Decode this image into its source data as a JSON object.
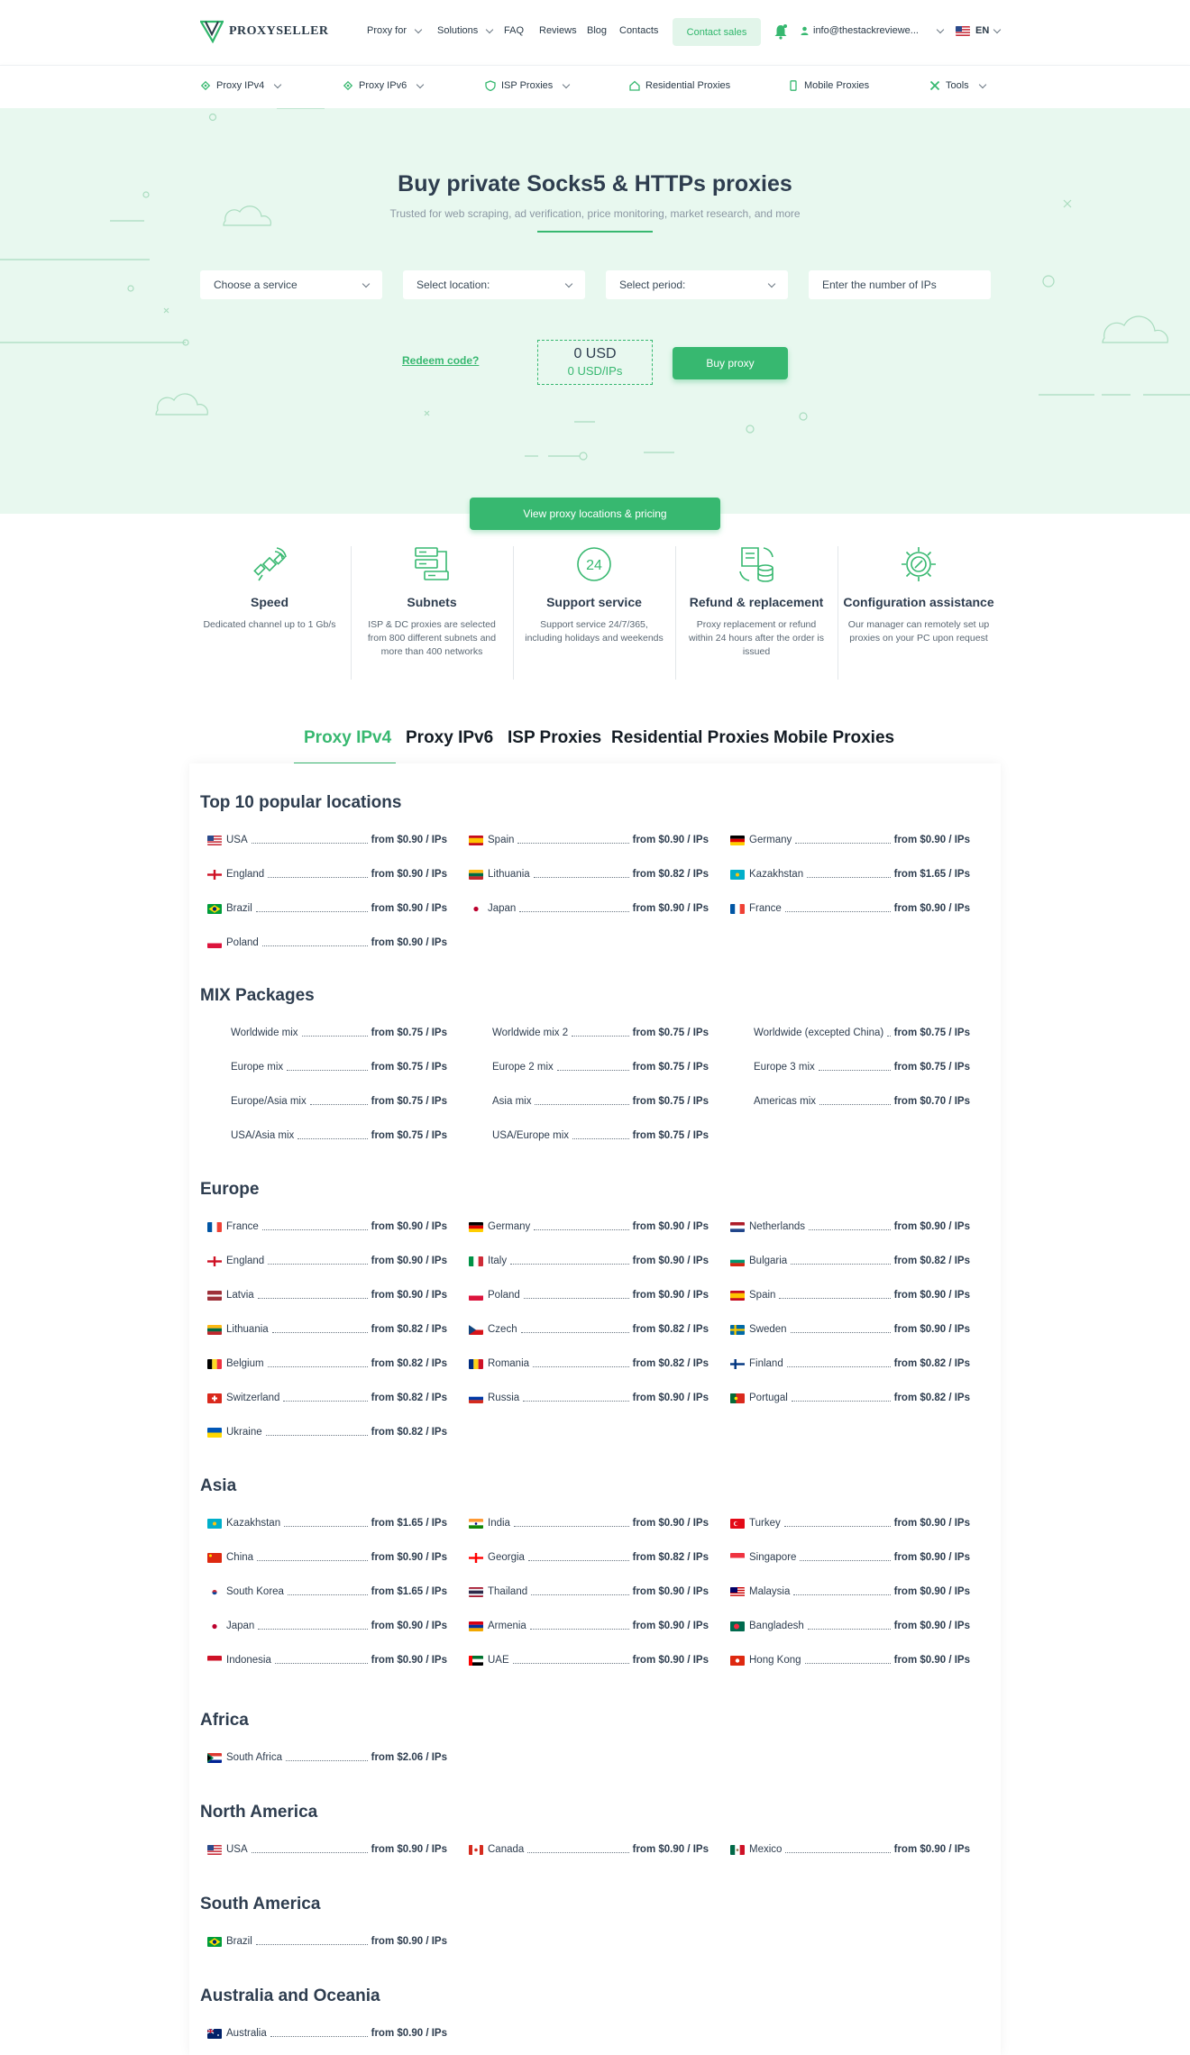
{
  "brand": {
    "name": "PROXYSELLER"
  },
  "header": {
    "nav": [
      "Proxy for",
      "Solutions",
      "FAQ",
      "Reviews",
      "Blog",
      "Contacts"
    ],
    "contact_label": "Contact sales",
    "email": "info@thestackreviewe...",
    "language": "EN"
  },
  "subnav": [
    "Proxy IPv4",
    "Proxy IPv6",
    "ISP Proxies",
    "Residential Proxies",
    "Mobile Proxies",
    "Tools"
  ],
  "hero": {
    "title": "Buy private Socks5 & HTTPs proxies",
    "subtitle": "Trusted for web scraping, ad verification, price monitoring, market research, and more",
    "service_placeholder": "Choose a service",
    "location_placeholder": "Select location:",
    "period_placeholder": "Select period:",
    "ips_placeholder": "Enter the number of IPs",
    "redeem": "Redeem code?",
    "total_usd": "0 USD",
    "total_per_ip": "0 USD/IPs",
    "buy": "Buy proxy",
    "view_locations": "View proxy locations & pricing"
  },
  "features": [
    {
      "title": "Speed",
      "desc": "Dedicated channel up to 1 Gb/s"
    },
    {
      "title": "Subnets",
      "desc": "ISP & DC proxies are selected from 800 different subnets and more than 400 networks"
    },
    {
      "title": "Support service",
      "desc": "Support service 24/7/365, including holidays and weekends"
    },
    {
      "title": "Refund & replacement",
      "desc": "Proxy replacement or refund within 24 hours after the order is issued"
    },
    {
      "title": "Configuration assistance",
      "desc": "Our manager can remotely set up proxies on your PC upon request"
    }
  ],
  "tabs": [
    "Proxy IPv4",
    "Proxy IPv6",
    "ISP Proxies",
    "Residential Proxies",
    "Mobile Proxies"
  ],
  "sections": [
    {
      "title": "Top 10 popular locations",
      "items": [
        {
          "name": "USA",
          "price": "from $0.90 / IPs",
          "flag": "us"
        },
        {
          "name": "Spain",
          "price": "from $0.90 / IPs",
          "flag": "es"
        },
        {
          "name": "Germany",
          "price": "from $0.90 / IPs",
          "flag": "de"
        },
        {
          "name": "England",
          "price": "from $0.90 / IPs",
          "flag": "en"
        },
        {
          "name": "Lithuania",
          "price": "from $0.82 / IPs",
          "flag": "lt"
        },
        {
          "name": "Kazakhstan",
          "price": "from $1.65 / IPs",
          "flag": "kz"
        },
        {
          "name": "Brazil",
          "price": "from $0.90 / IPs",
          "flag": "br"
        },
        {
          "name": "Japan",
          "price": "from $0.90 / IPs",
          "flag": "jp"
        },
        {
          "name": "France",
          "price": "from $0.90 / IPs",
          "flag": "fr"
        },
        {
          "name": "Poland",
          "price": "from $0.90 / IPs",
          "flag": "pl"
        }
      ]
    },
    {
      "title": "MIX Packages",
      "items": [
        {
          "name": "Worldwide mix",
          "price": "from $0.75 / IPs"
        },
        {
          "name": "Worldwide mix 2",
          "price": "from $0.75 / IPs"
        },
        {
          "name": "Worldwide (excepted China)",
          "price": "from $0.75 / IPs"
        },
        {
          "name": "Europe mix",
          "price": "from $0.75 / IPs"
        },
        {
          "name": "Europe 2 mix",
          "price": "from $0.75 / IPs"
        },
        {
          "name": "Europe 3 mix",
          "price": "from $0.75 / IPs"
        },
        {
          "name": "Europe/Asia mix",
          "price": "from $0.75 / IPs"
        },
        {
          "name": "Asia mix",
          "price": "from $0.75 / IPs"
        },
        {
          "name": "Americas mix",
          "price": "from $0.70 / IPs"
        },
        {
          "name": "USA/Asia mix",
          "price": "from $0.75 / IPs"
        },
        {
          "name": "USA/Europe mix",
          "price": "from $0.75 / IPs"
        }
      ]
    },
    {
      "title": "Europe",
      "items": [
        {
          "name": "France",
          "price": "from $0.90 / IPs",
          "flag": "fr"
        },
        {
          "name": "Germany",
          "price": "from $0.90 / IPs",
          "flag": "de"
        },
        {
          "name": "Netherlands",
          "price": "from $0.90 / IPs",
          "flag": "nl"
        },
        {
          "name": "England",
          "price": "from $0.90 / IPs",
          "flag": "en"
        },
        {
          "name": "Italy",
          "price": "from $0.90 / IPs",
          "flag": "it"
        },
        {
          "name": "Bulgaria",
          "price": "from $0.82 / IPs",
          "flag": "bg"
        },
        {
          "name": "Latvia",
          "price": "from $0.90 / IPs",
          "flag": "lv"
        },
        {
          "name": "Poland",
          "price": "from $0.90 / IPs",
          "flag": "pl"
        },
        {
          "name": "Spain",
          "price": "from $0.90 / IPs",
          "flag": "es"
        },
        {
          "name": "Lithuania",
          "price": "from $0.82 / IPs",
          "flag": "lt"
        },
        {
          "name": "Czech",
          "price": "from $0.82 / IPs",
          "flag": "cz"
        },
        {
          "name": "Sweden",
          "price": "from $0.90 / IPs",
          "flag": "se"
        },
        {
          "name": "Belgium",
          "price": "from $0.82 / IPs",
          "flag": "be"
        },
        {
          "name": "Romania",
          "price": "from $0.82 / IPs",
          "flag": "ro"
        },
        {
          "name": "Finland",
          "price": "from $0.82 / IPs",
          "flag": "fi"
        },
        {
          "name": "Switzerland",
          "price": "from $0.82 / IPs",
          "flag": "ch"
        },
        {
          "name": "Russia",
          "price": "from $0.90 / IPs",
          "flag": "ru"
        },
        {
          "name": "Portugal",
          "price": "from $0.82 / IPs",
          "flag": "pt"
        },
        {
          "name": "Ukraine",
          "price": "from $0.82 / IPs",
          "flag": "ua"
        }
      ]
    },
    {
      "title": "Asia",
      "items": [
        {
          "name": "Kazakhstan",
          "price": "from $1.65 / IPs",
          "flag": "kz"
        },
        {
          "name": "India",
          "price": "from $0.90 / IPs",
          "flag": "in"
        },
        {
          "name": "Turkey",
          "price": "from $0.90 / IPs",
          "flag": "tr"
        },
        {
          "name": "China",
          "price": "from $0.90 / IPs",
          "flag": "cn"
        },
        {
          "name": "Georgia",
          "price": "from $0.82 / IPs",
          "flag": "ge"
        },
        {
          "name": "Singapore",
          "price": "from $0.90 / IPs",
          "flag": "sg"
        },
        {
          "name": "South Korea",
          "price": "from $1.65 / IPs",
          "flag": "kr"
        },
        {
          "name": "Thailand",
          "price": "from $0.90 / IPs",
          "flag": "th"
        },
        {
          "name": "Malaysia",
          "price": "from $0.90 / IPs",
          "flag": "my"
        },
        {
          "name": "Japan",
          "price": "from $0.90 / IPs",
          "flag": "jp"
        },
        {
          "name": "Armenia",
          "price": "from $0.90 / IPs",
          "flag": "am"
        },
        {
          "name": "Bangladesh",
          "price": "from $0.90 / IPs",
          "flag": "bd"
        },
        {
          "name": "Indonesia",
          "price": "from $0.90 / IPs",
          "flag": "id"
        },
        {
          "name": "UAE",
          "price": "from $0.90 / IPs",
          "flag": "ae"
        },
        {
          "name": "Hong Kong",
          "price": "from $0.90 / IPs",
          "flag": "hk"
        }
      ]
    },
    {
      "title": "Africa",
      "items": [
        {
          "name": "South Africa",
          "price": "from $2.06 / IPs",
          "flag": "za"
        }
      ]
    },
    {
      "title": "North America",
      "items": [
        {
          "name": "USA",
          "price": "from $0.90 / IPs",
          "flag": "us"
        },
        {
          "name": "Canada",
          "price": "from $0.90 / IPs",
          "flag": "ca"
        },
        {
          "name": "Mexico",
          "price": "from $0.90 / IPs",
          "flag": "mx"
        }
      ]
    },
    {
      "title": "South America",
      "items": [
        {
          "name": "Brazil",
          "price": "from $0.90 / IPs",
          "flag": "br"
        }
      ]
    },
    {
      "title": "Australia and Oceania",
      "items": [
        {
          "name": "Australia",
          "price": "from $0.90 / IPs",
          "flag": "au"
        }
      ]
    }
  ],
  "colors": {
    "accent": "#37b870",
    "hero_bg": "#e8f8ef",
    "text": "#2e3d4f"
  }
}
